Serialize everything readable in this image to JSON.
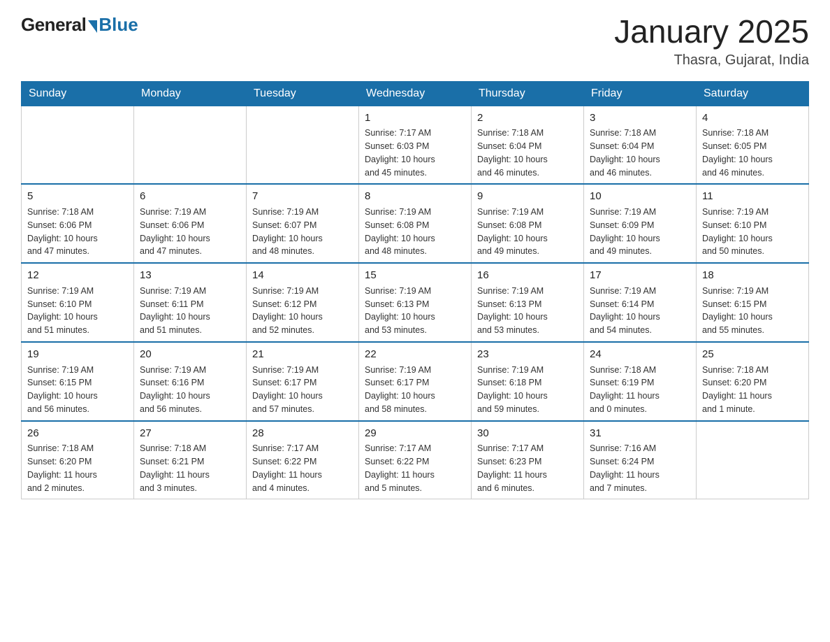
{
  "logo": {
    "general": "General",
    "blue": "Blue"
  },
  "header": {
    "month": "January 2025",
    "location": "Thasra, Gujarat, India"
  },
  "weekdays": [
    "Sunday",
    "Monday",
    "Tuesday",
    "Wednesday",
    "Thursday",
    "Friday",
    "Saturday"
  ],
  "weeks": [
    [
      {
        "day": "",
        "info": ""
      },
      {
        "day": "",
        "info": ""
      },
      {
        "day": "",
        "info": ""
      },
      {
        "day": "1",
        "info": "Sunrise: 7:17 AM\nSunset: 6:03 PM\nDaylight: 10 hours\nand 45 minutes."
      },
      {
        "day": "2",
        "info": "Sunrise: 7:18 AM\nSunset: 6:04 PM\nDaylight: 10 hours\nand 46 minutes."
      },
      {
        "day": "3",
        "info": "Sunrise: 7:18 AM\nSunset: 6:04 PM\nDaylight: 10 hours\nand 46 minutes."
      },
      {
        "day": "4",
        "info": "Sunrise: 7:18 AM\nSunset: 6:05 PM\nDaylight: 10 hours\nand 46 minutes."
      }
    ],
    [
      {
        "day": "5",
        "info": "Sunrise: 7:18 AM\nSunset: 6:06 PM\nDaylight: 10 hours\nand 47 minutes."
      },
      {
        "day": "6",
        "info": "Sunrise: 7:19 AM\nSunset: 6:06 PM\nDaylight: 10 hours\nand 47 minutes."
      },
      {
        "day": "7",
        "info": "Sunrise: 7:19 AM\nSunset: 6:07 PM\nDaylight: 10 hours\nand 48 minutes."
      },
      {
        "day": "8",
        "info": "Sunrise: 7:19 AM\nSunset: 6:08 PM\nDaylight: 10 hours\nand 48 minutes."
      },
      {
        "day": "9",
        "info": "Sunrise: 7:19 AM\nSunset: 6:08 PM\nDaylight: 10 hours\nand 49 minutes."
      },
      {
        "day": "10",
        "info": "Sunrise: 7:19 AM\nSunset: 6:09 PM\nDaylight: 10 hours\nand 49 minutes."
      },
      {
        "day": "11",
        "info": "Sunrise: 7:19 AM\nSunset: 6:10 PM\nDaylight: 10 hours\nand 50 minutes."
      }
    ],
    [
      {
        "day": "12",
        "info": "Sunrise: 7:19 AM\nSunset: 6:10 PM\nDaylight: 10 hours\nand 51 minutes."
      },
      {
        "day": "13",
        "info": "Sunrise: 7:19 AM\nSunset: 6:11 PM\nDaylight: 10 hours\nand 51 minutes."
      },
      {
        "day": "14",
        "info": "Sunrise: 7:19 AM\nSunset: 6:12 PM\nDaylight: 10 hours\nand 52 minutes."
      },
      {
        "day": "15",
        "info": "Sunrise: 7:19 AM\nSunset: 6:13 PM\nDaylight: 10 hours\nand 53 minutes."
      },
      {
        "day": "16",
        "info": "Sunrise: 7:19 AM\nSunset: 6:13 PM\nDaylight: 10 hours\nand 53 minutes."
      },
      {
        "day": "17",
        "info": "Sunrise: 7:19 AM\nSunset: 6:14 PM\nDaylight: 10 hours\nand 54 minutes."
      },
      {
        "day": "18",
        "info": "Sunrise: 7:19 AM\nSunset: 6:15 PM\nDaylight: 10 hours\nand 55 minutes."
      }
    ],
    [
      {
        "day": "19",
        "info": "Sunrise: 7:19 AM\nSunset: 6:15 PM\nDaylight: 10 hours\nand 56 minutes."
      },
      {
        "day": "20",
        "info": "Sunrise: 7:19 AM\nSunset: 6:16 PM\nDaylight: 10 hours\nand 56 minutes."
      },
      {
        "day": "21",
        "info": "Sunrise: 7:19 AM\nSunset: 6:17 PM\nDaylight: 10 hours\nand 57 minutes."
      },
      {
        "day": "22",
        "info": "Sunrise: 7:19 AM\nSunset: 6:17 PM\nDaylight: 10 hours\nand 58 minutes."
      },
      {
        "day": "23",
        "info": "Sunrise: 7:19 AM\nSunset: 6:18 PM\nDaylight: 10 hours\nand 59 minutes."
      },
      {
        "day": "24",
        "info": "Sunrise: 7:18 AM\nSunset: 6:19 PM\nDaylight: 11 hours\nand 0 minutes."
      },
      {
        "day": "25",
        "info": "Sunrise: 7:18 AM\nSunset: 6:20 PM\nDaylight: 11 hours\nand 1 minute."
      }
    ],
    [
      {
        "day": "26",
        "info": "Sunrise: 7:18 AM\nSunset: 6:20 PM\nDaylight: 11 hours\nand 2 minutes."
      },
      {
        "day": "27",
        "info": "Sunrise: 7:18 AM\nSunset: 6:21 PM\nDaylight: 11 hours\nand 3 minutes."
      },
      {
        "day": "28",
        "info": "Sunrise: 7:17 AM\nSunset: 6:22 PM\nDaylight: 11 hours\nand 4 minutes."
      },
      {
        "day": "29",
        "info": "Sunrise: 7:17 AM\nSunset: 6:22 PM\nDaylight: 11 hours\nand 5 minutes."
      },
      {
        "day": "30",
        "info": "Sunrise: 7:17 AM\nSunset: 6:23 PM\nDaylight: 11 hours\nand 6 minutes."
      },
      {
        "day": "31",
        "info": "Sunrise: 7:16 AM\nSunset: 6:24 PM\nDaylight: 11 hours\nand 7 minutes."
      },
      {
        "day": "",
        "info": ""
      }
    ]
  ]
}
